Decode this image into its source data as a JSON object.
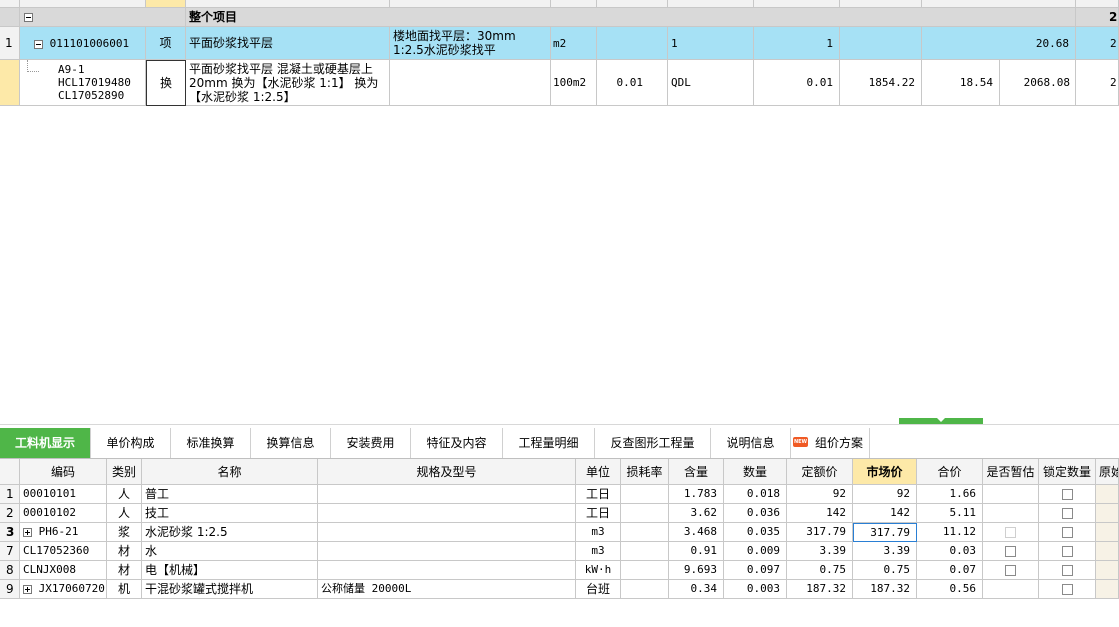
{
  "top": {
    "group_label": "整个项目",
    "group_right_fragment": "2",
    "row1": {
      "index": "1",
      "code": "011101006001",
      "type": "项",
      "name": "平面砂浆找平层",
      "feature": "楼地面找平层：30mm 1:2.5水泥砂浆找平",
      "unit": "m2",
      "expr": "1",
      "qty": "1",
      "total": "20.68",
      "fragment": "2"
    },
    "row2": {
      "code_lines": [
        "A9-1",
        "HCL17019480",
        "CL17052890"
      ],
      "type": "换",
      "name": "平面砂浆找平层 混凝土或硬基层上 20mm  换为【水泥砂浆 1:1】 换为【水泥砂浆 1:2.5】",
      "unit": "100m2",
      "content": "0.01",
      "expr": "QDL",
      "qty": "0.01",
      "unit_price": "1854.22",
      "price2": "18.54",
      "total": "2068.08",
      "fragment": "2"
    }
  },
  "tabs": [
    {
      "label": "工料机显示"
    },
    {
      "label": "单价构成"
    },
    {
      "label": "标准换算"
    },
    {
      "label": "换算信息"
    },
    {
      "label": "安装费用"
    },
    {
      "label": "特征及内容"
    },
    {
      "label": "工程量明细"
    },
    {
      "label": "反查图形工程量"
    },
    {
      "label": "说明信息"
    },
    {
      "label": "组价方案",
      "badge": "NEW"
    }
  ],
  "bottom": {
    "columns": [
      "编码",
      "类别",
      "名称",
      "规格及型号",
      "单位",
      "损耗率",
      "含量",
      "数量",
      "定额价",
      "市场价",
      "合价",
      "是否暂估",
      "锁定数量",
      "原始"
    ],
    "rows": [
      {
        "idx": "1",
        "code": "00010101",
        "cat": "人",
        "name": "普工",
        "spec": "",
        "unit": "工日",
        "loss": "",
        "content": "1.783",
        "qty": "0.018",
        "quota": "92",
        "market": "92",
        "sum": "1.66"
      },
      {
        "idx": "2",
        "code": "00010102",
        "cat": "人",
        "name": "技工",
        "spec": "",
        "unit": "工日",
        "loss": "",
        "content": "3.62",
        "qty": "0.036",
        "quota": "142",
        "market": "142",
        "sum": "5.11"
      },
      {
        "idx": "3",
        "code": "PH6-21",
        "cat": "浆",
        "name": "水泥砂浆 1:2.5",
        "spec": "",
        "unit": "m3",
        "loss": "",
        "content": "3.468",
        "qty": "0.035",
        "quota": "317.79",
        "market": "317.79",
        "sum": "11.12"
      },
      {
        "idx": "7",
        "code": "CL17052360",
        "cat": "材",
        "name": "水",
        "spec": "",
        "unit": "m3",
        "loss": "",
        "content": "0.91",
        "qty": "0.009",
        "quota": "3.39",
        "market": "3.39",
        "sum": "0.03"
      },
      {
        "idx": "8",
        "code": "CLNJX008",
        "cat": "材",
        "name": "电【机械】",
        "spec": "",
        "unit": "kW·h",
        "loss": "",
        "content": "9.693",
        "qty": "0.097",
        "quota": "0.75",
        "market": "0.75",
        "sum": "0.07"
      },
      {
        "idx": "9",
        "code": "JX17060720",
        "cat": "机",
        "name": "干混砂浆罐式搅拌机",
        "spec": "公称储量 20000L",
        "unit": "台班",
        "loss": "",
        "content": "0.34",
        "qty": "0.003",
        "quota": "187.32",
        "market": "187.32",
        "sum": "0.56"
      }
    ]
  },
  "colors": {
    "selected_row": "#a6e1f5",
    "active_tab": "#4fb648",
    "market_header": "#fde9a8",
    "splitter": "#4fb648"
  }
}
